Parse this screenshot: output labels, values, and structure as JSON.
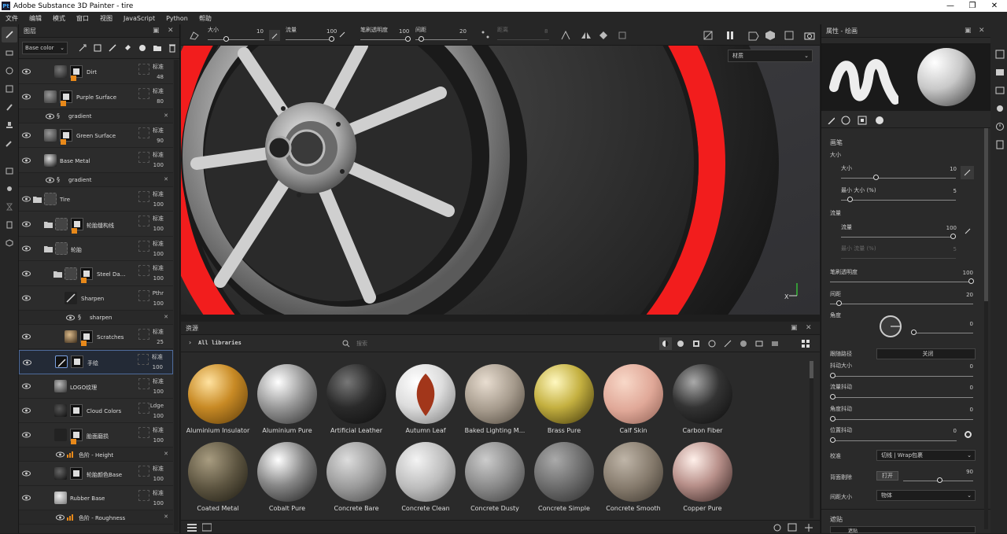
{
  "window": {
    "title": "Adobe Substance 3D Painter - tire"
  },
  "menu": [
    "文件",
    "编辑",
    "模式",
    "窗口",
    "视图",
    "JavaScript",
    "Python",
    "帮助"
  ],
  "layers_panel": {
    "title": "图层",
    "channel": "Base color",
    "rows": [
      {
        "name": "Dirt",
        "blend": "标准",
        "opacity": "48"
      },
      {
        "name": "Purple Surface",
        "blend": "标准",
        "opacity": "80"
      },
      {
        "name": "gradient"
      },
      {
        "name": "Green Surface",
        "blend": "标准",
        "opacity": "90"
      },
      {
        "name": "Base Metal",
        "blend": "标准",
        "opacity": "100"
      },
      {
        "name": "gradient"
      },
      {
        "name": "Tire",
        "blend": "标准",
        "opacity": "100"
      },
      {
        "name": "轮胎缝构线",
        "blend": "标准",
        "opacity": "100"
      },
      {
        "name": "轮胎",
        "blend": "标准",
        "opacity": "100"
      },
      {
        "name": "Steel Da…",
        "blend": "标准",
        "opacity": "100"
      },
      {
        "name": "Sharpen",
        "blend": "Pthr",
        "opacity": "100"
      },
      {
        "name": "sharpen"
      },
      {
        "name": "Scratches",
        "blend": "标准",
        "opacity": "25"
      },
      {
        "name": "手绘",
        "blend": "标准",
        "opacity": "100"
      },
      {
        "name": "LOGO纹理",
        "blend": "标准",
        "opacity": "100"
      },
      {
        "name": "Cloud Colors",
        "blend": "Ldge",
        "opacity": "100"
      },
      {
        "name": "胎面磨损",
        "blend": "标准",
        "opacity": "100"
      },
      {
        "name": "色阶 - Height"
      },
      {
        "name": "轮胎颜色Base",
        "blend": "标准",
        "opacity": "100"
      },
      {
        "name": "Rubber Base",
        "blend": "标准",
        "opacity": "100"
      },
      {
        "name": "色阶 - Roughness"
      }
    ]
  },
  "viewport_toolbar": {
    "size_label": "大小",
    "size_value": "10",
    "flow_label": "流量",
    "flow_value": "100",
    "stroke_opacity_label": "笔刷透明度",
    "stroke_opacity_value": "100",
    "spacing_label": "间距",
    "spacing_value": "20",
    "distance_label": "距离",
    "distance_value": "8"
  },
  "viewport": {
    "material_mode": "材质"
  },
  "assets_panel": {
    "title": "资源",
    "library": "All libraries",
    "search_placeholder": "搜索",
    "materials": [
      {
        "name": "Aluminium Insulator"
      },
      {
        "name": "Aluminium Pure"
      },
      {
        "name": "Artificial Leather"
      },
      {
        "name": "Autumn Leaf"
      },
      {
        "name": "Baked Lighting M..."
      },
      {
        "name": "Brass Pure"
      },
      {
        "name": "Calf Skin"
      },
      {
        "name": "Carbon Fiber"
      },
      {
        "name": "Coated Metal"
      },
      {
        "name": "Cobalt Pure"
      },
      {
        "name": "Concrete Bare"
      },
      {
        "name": "Concrete Clean"
      },
      {
        "name": "Concrete Dusty"
      },
      {
        "name": "Concrete Simple"
      },
      {
        "name": "Concrete Smooth"
      },
      {
        "name": "Copper Pure"
      }
    ]
  },
  "properties_panel": {
    "title": "属性 - 绘画",
    "brush_section": "画笔",
    "size_group": "大小",
    "size_label": "大小",
    "size_value": "10",
    "min_size_label": "最小 大小 (%)",
    "min_size_value": "5",
    "flow_group": "流量",
    "flow_label": "流量",
    "flow_value": "100",
    "min_flow_label": "最小 流量 (%)",
    "min_flow_value": "5",
    "stroke_opacity_label": "笔刷透明度",
    "stroke_opacity_value": "100",
    "spacing_label": "间距",
    "spacing_value": "20",
    "angle_label": "角度",
    "angle_value": "0",
    "follow_path_label": "跟随路径",
    "follow_path_value": "关闭",
    "size_jitter_label": "抖动大小",
    "size_jitter_value": "0",
    "flow_jitter_label": "流量抖动",
    "flow_jitter_value": "0",
    "angle_jitter_label": "角度抖动",
    "angle_jitter_value": "0",
    "position_jitter_label": "位置抖动",
    "position_jitter_value": "0",
    "alignment_label": "校准",
    "alignment_value": "切线 | Wrap包裹",
    "backface_label": "背面剔除",
    "backface_toggle": "打开",
    "backface_value": "90",
    "spacing_size_label": "间距大小",
    "spacing_size_value": "物体",
    "alpha_section": "遮贴",
    "alpha_item": "遮贴"
  },
  "colors": {
    "accent_orange": "#e8891a",
    "tire_red": "#f21d1d",
    "selection_blue": "#4e6a9a"
  }
}
